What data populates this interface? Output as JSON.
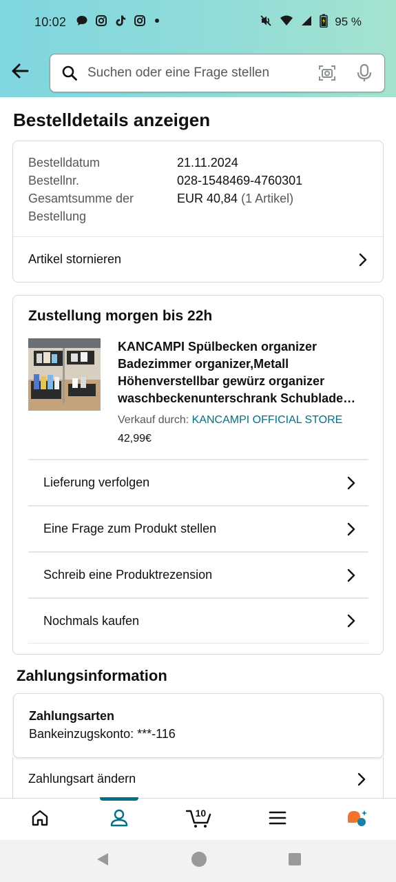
{
  "status_bar": {
    "time": "10:02",
    "battery": "95 %"
  },
  "search": {
    "placeholder": "Suchen oder eine Frage stellen"
  },
  "page_title": "Bestelldetails anzeigen",
  "order_info": {
    "rows": [
      {
        "label": "Bestelldatum",
        "value": "21.11.2024"
      },
      {
        "label": "Bestellnr.",
        "value": "028-1548469-4760301"
      },
      {
        "label_line1": "Gesamtsumme der",
        "label_line2": "Bestellung",
        "value": "EUR 40,84",
        "value_suffix": "(1 Artikel)"
      }
    ],
    "cancel_label": "Artikel stornieren"
  },
  "delivery": {
    "title": "Zustellung morgen bis 22h",
    "product_title": "KANCAMPI Spülbecken organizer Badezimmer organizer,Metall Höhenverstellbar gewürz organizer waschbeckenunterschrank Schublade…",
    "seller_prefix": "Verkauf durch:",
    "seller_name": "KANCAMPI OFFICIAL STORE",
    "price": "42,99€",
    "actions": [
      "Lieferung verfolgen",
      "Eine Frage zum Produkt stellen",
      "Schreib eine Produktrezension",
      "Nochmals kaufen"
    ]
  },
  "payment": {
    "heading": "Zahlungsinformation",
    "type_label": "Zahlungsarten",
    "type_value": "Bankeinzugskonto: ***-116",
    "change_label": "Zahlungsart ändern"
  },
  "bottom_nav": {
    "cart_count": "10",
    "active": "account"
  },
  "colors": {
    "header_gradient_start": "#7fd6e0",
    "header_gradient_end": "#a5e3cf",
    "link": "#007185",
    "active_nav": "#007185",
    "text": "#0f1111",
    "muted": "#565959"
  }
}
